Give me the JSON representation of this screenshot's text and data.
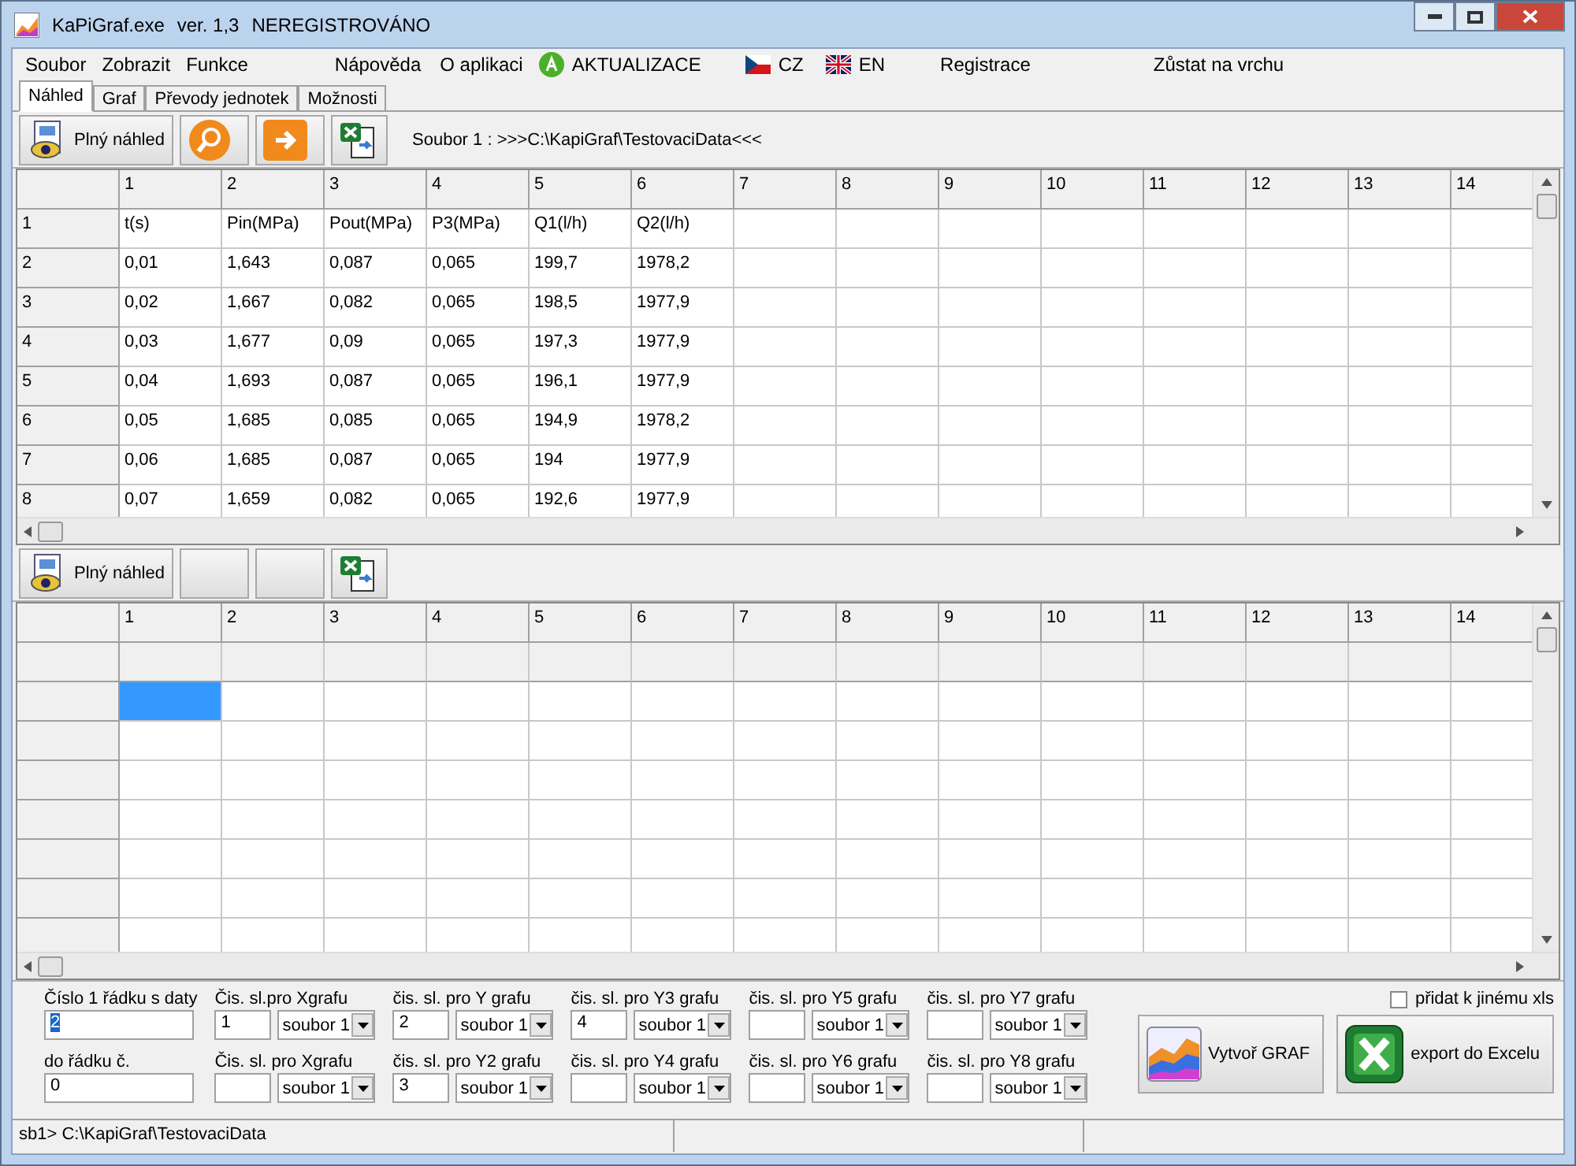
{
  "window": {
    "title": "KaPiGraf.exe",
    "version": "ver. 1,3",
    "registration": "NEREGISTROVÁNO"
  },
  "menu": [
    {
      "kind": "text",
      "label": "Soubor"
    },
    {
      "kind": "text",
      "label": "Zobrazit"
    },
    {
      "kind": "text",
      "label": "Funkce"
    },
    {
      "kind": "text",
      "label": "Nápověda"
    },
    {
      "kind": "text",
      "label": "O aplikaci"
    },
    {
      "kind": "update",
      "label": "AKTUALIZACE"
    },
    {
      "kind": "flag_cz",
      "label": "CZ"
    },
    {
      "kind": "flag_en",
      "label": "EN"
    },
    {
      "kind": "text",
      "label": "Registrace"
    },
    {
      "kind": "text",
      "label": "Zůstat na vrchu"
    }
  ],
  "tabs": [
    {
      "label": "Náhled",
      "selected": true
    },
    {
      "label": "Graf",
      "selected": false
    },
    {
      "label": "Převody jednotek",
      "selected": false
    },
    {
      "label": "Možnosti",
      "selected": false
    }
  ],
  "toolbar_1": {
    "buttons": [
      {
        "kind": "preview",
        "label": "Plný náhled"
      },
      {
        "kind": "search"
      },
      {
        "kind": "arrow"
      },
      {
        "kind": "excel"
      }
    ],
    "file_label": "Soubor 1 : >>>C:\\KapiGraf\\TestovaciData<<<"
  },
  "grid_1": {
    "columns": [
      "1",
      "2",
      "3",
      "4",
      "5",
      "6",
      "7",
      "8",
      "9",
      "10",
      "11",
      "12",
      "13",
      "14"
    ],
    "rows": [
      {
        "header": "1",
        "cells": [
          "t(s)",
          "Pin(MPa)",
          "Pout(MPa)",
          "P3(MPa)",
          "Q1(l/h)",
          "Q2(l/h)"
        ]
      },
      {
        "header": "2",
        "cells": [
          "0,01",
          "1,643",
          "0,087",
          "0,065",
          "199,7",
          "1978,2"
        ]
      },
      {
        "header": "3",
        "cells": [
          "0,02",
          "1,667",
          "0,082",
          "0,065",
          "198,5",
          "1977,9"
        ]
      },
      {
        "header": "4",
        "cells": [
          "0,03",
          "1,677",
          "0,09",
          "0,065",
          "197,3",
          "1977,9"
        ]
      },
      {
        "header": "5",
        "cells": [
          "0,04",
          "1,693",
          "0,087",
          "0,065",
          "196,1",
          "1977,9"
        ]
      },
      {
        "header": "6",
        "cells": [
          "0,05",
          "1,685",
          "0,085",
          "0,065",
          "194,9",
          "1978,2"
        ]
      },
      {
        "header": "7",
        "cells": [
          "0,06",
          "1,685",
          "0,087",
          "0,065",
          "194",
          "1977,9"
        ]
      },
      {
        "header": "8",
        "cells": [
          "0,07",
          "1,659",
          "0,082",
          "0,065",
          "192,6",
          "1977,9"
        ]
      }
    ]
  },
  "toolbar_2": {
    "buttons": [
      {
        "kind": "preview",
        "label": "Plný náhled"
      },
      {
        "kind": "blank"
      },
      {
        "kind": "blank"
      },
      {
        "kind": "excel"
      }
    ]
  },
  "grid_2": {
    "columns": [
      "1",
      "2",
      "3",
      "4",
      "5",
      "6",
      "7",
      "8",
      "9",
      "10",
      "11",
      "12",
      "13",
      "14"
    ],
    "rows": [
      {
        "selected": true
      },
      {
        "selected": false
      },
      {
        "selected": false
      },
      {
        "selected": false
      },
      {
        "selected": false
      },
      {
        "selected": false
      },
      {
        "selected": false
      }
    ]
  },
  "row_fields": [
    {
      "label": "Číslo 1 řádku s daty",
      "value": "2",
      "text_selected": true
    },
    {
      "label": "do řádku č.",
      "value": "0",
      "text_selected": false
    }
  ],
  "column_groups": [
    [
      {
        "label": "Čis. sl.pro Xgrafu",
        "value": "1",
        "source": "soubor 1"
      },
      {
        "label": "Čis. sl. pro Xgrafu",
        "source": "soubor 1"
      }
    ],
    [
      {
        "label": "čis. sl. pro Y grafu",
        "value": "2",
        "source": "soubor 1"
      },
      {
        "label": "čis. sl. pro Y2 grafu",
        "value": "3",
        "source": "soubor 1"
      }
    ],
    [
      {
        "label": "čis. sl. pro Y3 grafu",
        "value": "4",
        "source": "soubor 1"
      },
      {
        "label": "čis. sl. pro Y4 grafu",
        "source": "soubor 1"
      }
    ],
    [
      {
        "label": "čis. sl. pro Y5 grafu",
        "source": "soubor 1"
      },
      {
        "label": "čis. sl. pro Y6 grafu",
        "source": "soubor 1"
      }
    ],
    [
      {
        "label": "čis. sl. pro Y7 grafu",
        "source": "soubor 1"
      },
      {
        "label": "čis. sl. pro Y8 grafu",
        "source": "soubor 1"
      }
    ]
  ],
  "append_checkbox": {
    "label": "přidat k jinému xls",
    "checked": false
  },
  "action_buttons": [
    {
      "kind": "chart",
      "label": "Vytvoř GRAF"
    },
    {
      "kind": "excel",
      "label": "export do Excelu"
    }
  ],
  "status_bar": {
    "text": "sb1> C:\\KapiGraf\\TestovaciData"
  }
}
